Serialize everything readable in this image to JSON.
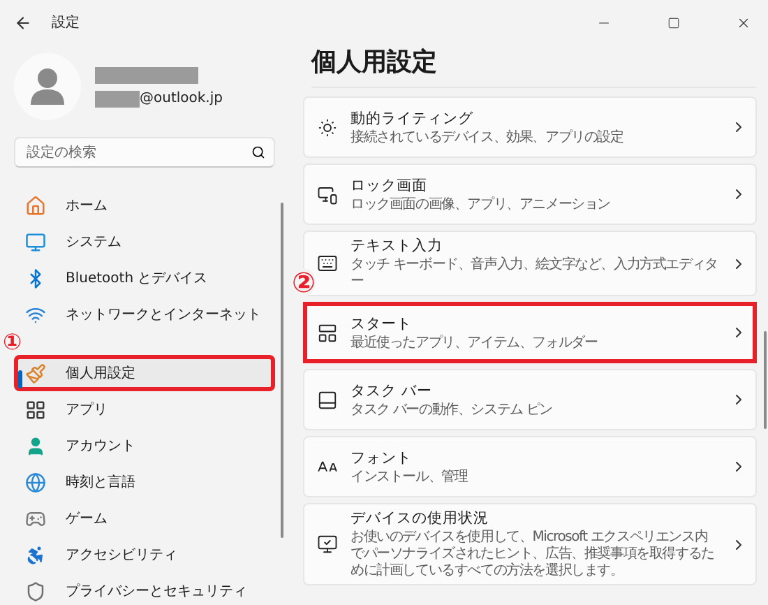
{
  "window": {
    "title": "設定"
  },
  "profile": {
    "email_suffix": "@outlook.jp"
  },
  "search": {
    "placeholder": "設定の検索"
  },
  "nav": [
    {
      "label": "ホーム",
      "selected": false,
      "highlighted": false
    },
    {
      "label": "システム",
      "selected": false,
      "highlighted": false
    },
    {
      "label": "Bluetooth とデバイス",
      "selected": false,
      "highlighted": false
    },
    {
      "label": "ネットワークとインターネット",
      "selected": false,
      "highlighted": false
    },
    {
      "label": "個人用設定",
      "selected": true,
      "highlighted": true,
      "callout": "①"
    },
    {
      "label": "アプリ",
      "selected": false,
      "highlighted": false
    },
    {
      "label": "アカウント",
      "selected": false,
      "highlighted": false
    },
    {
      "label": "時刻と言語",
      "selected": false,
      "highlighted": false
    },
    {
      "label": "ゲーム",
      "selected": false,
      "highlighted": false
    },
    {
      "label": "アクセシビリティ",
      "selected": false,
      "highlighted": false
    },
    {
      "label": "プライバシーとセキュリティ",
      "selected": false,
      "highlighted": false
    }
  ],
  "page_title": "個人用設定",
  "cards": [
    {
      "title": "動的ライティング",
      "description": "接続されているデバイス、効果、アプリの設定",
      "highlighted": false
    },
    {
      "title": "ロック画面",
      "description": "ロック画面の画像、アプリ、アニメーション",
      "highlighted": false
    },
    {
      "title": "テキスト入力",
      "description": "タッチ キーボード、音声入力、絵文字など、入力方式エディター",
      "highlighted": false
    },
    {
      "title": "スタート",
      "description": "最近使ったアプリ、アイテム、フォルダー",
      "highlighted": true,
      "callout": "②"
    },
    {
      "title": "タスク バー",
      "description": "タスク バーの動作、システム ピン",
      "highlighted": false
    },
    {
      "title": "フォント",
      "description": "インストール、管理",
      "highlighted": false
    },
    {
      "title": "デバイスの使用状況",
      "description": "お使いのデバイスを使用して、Microsoft エクスペリエンス内でパーソナライズされたヒント、広告、推奨事項を取得するために計画しているすべての方法を選択します。",
      "highlighted": false
    }
  ]
}
